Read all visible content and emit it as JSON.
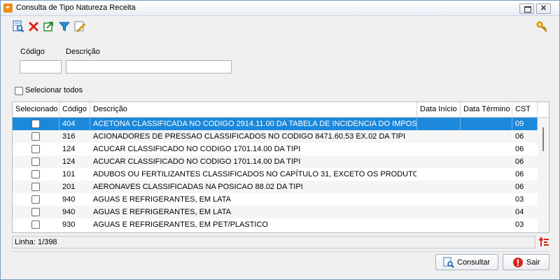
{
  "window": {
    "title": "Consulta de Tipo Natureza Receita",
    "close_glyph": "✕"
  },
  "toolbar": {
    "icons": [
      "search-document-icon",
      "delete-icon",
      "export-icon",
      "filter-icon",
      "edit-icon",
      "key-icon"
    ]
  },
  "filters": {
    "codigo_label": "Código",
    "codigo_value": "",
    "descricao_label": "Descrição",
    "descricao_value": ""
  },
  "select_all": {
    "label": "Selecionar todos",
    "checked": false
  },
  "grid": {
    "columns": [
      "Selecionado",
      "Código",
      "Descrição",
      "Data Início",
      "Data Término",
      "CST"
    ],
    "rows": [
      {
        "codigo": "404",
        "descricao": "ACETONA CLASSIFICADA NO CODIGO 2914.11.00 DA TABELA DE INCIDENCIA DO IMPOSTO SOBRE...",
        "data_inicio": "",
        "data_termino": "",
        "cst": "09",
        "selected": true
      },
      {
        "codigo": "316",
        "descricao": "ACIONADORES DE PRESSAO CLASSIFICADOS NO CODIGO 8471.60.53 EX.02 DA TIPI",
        "data_inicio": "",
        "data_termino": "",
        "cst": "06",
        "selected": false
      },
      {
        "codigo": "124",
        "descricao": "ACUCAR CLASSIFICADO NO CODIGO 1701.14.00 DA TIPI",
        "data_inicio": "",
        "data_termino": "",
        "cst": "06",
        "selected": false
      },
      {
        "codigo": "124",
        "descricao": "ACUCAR CLASSIFICADO NO CODIGO 1701.14.00 DA TIPI",
        "data_inicio": "",
        "data_termino": "",
        "cst": "06",
        "selected": false
      },
      {
        "codigo": "101",
        "descricao": "ADUBOS OU FERTILIZANTES CLASSIFICADOS NO CAPÍTULO 31, EXCETO OS PRODUTOS DE USO VE...",
        "data_inicio": "",
        "data_termino": "",
        "cst": "06",
        "selected": false
      },
      {
        "codigo": "201",
        "descricao": "AERONAVES CLASSIFICADAS NA POSICAO 88.02 DA TIPI",
        "data_inicio": "",
        "data_termino": "",
        "cst": "06",
        "selected": false
      },
      {
        "codigo": "940",
        "descricao": "AGUAS E REFRIGERANTES, EM LATA",
        "data_inicio": "",
        "data_termino": "",
        "cst": "03",
        "selected": false
      },
      {
        "codigo": "940",
        "descricao": "AGUAS E REFRIGERANTES, EM LATA",
        "data_inicio": "",
        "data_termino": "",
        "cst": "04",
        "selected": false
      },
      {
        "codigo": "930",
        "descricao": "AGUAS E REFRIGERANTES, EM PET/PLASTICO",
        "data_inicio": "",
        "data_termino": "",
        "cst": "03",
        "selected": false
      }
    ]
  },
  "status": {
    "line_text": "Linha: 1/398",
    "icon": "sort-order-icon"
  },
  "buttons": {
    "consultar": "Consultar",
    "sair": "Sair"
  },
  "colors": {
    "selection": "#1c88da",
    "accent_orange": "#f08a1a",
    "sair_red": "#d9241c"
  }
}
